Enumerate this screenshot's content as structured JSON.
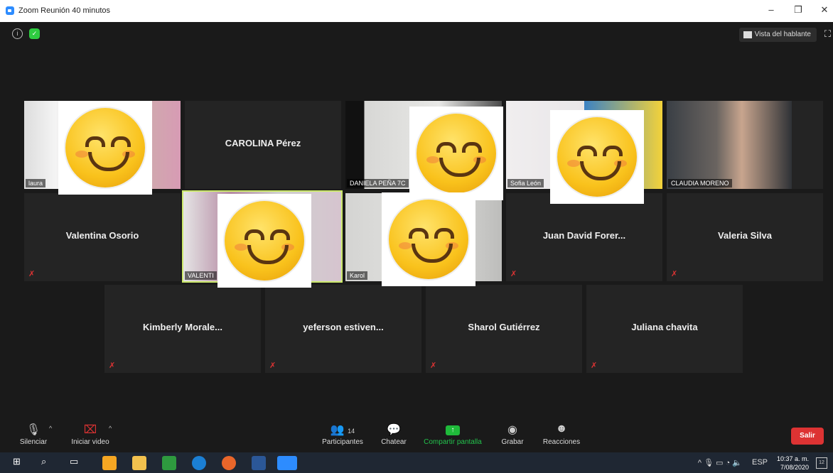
{
  "window": {
    "title": "Zoom Reunión 40 minutos",
    "minimize": "–",
    "restore": "❐",
    "close": "✕"
  },
  "top": {
    "speaker_view": "Vista del hablante"
  },
  "participants": [
    {
      "name": "laura",
      "label": "laura"
    },
    {
      "name": "CAROLINA Pérez"
    },
    {
      "name": "DANIELA PEÑA",
      "label": "DANIELA PEÑA 7C"
    },
    {
      "name": "Sofía León",
      "label": "Sofia León"
    },
    {
      "name": "CLAUDIA MORENO",
      "label": "CLAUDIA MORENO"
    },
    {
      "name": "Valentina Osorio"
    },
    {
      "name": "VALENTINA",
      "label": "VALENTI"
    },
    {
      "name": "Karol",
      "label": "Karol"
    },
    {
      "name": "Juan David Forer..."
    },
    {
      "name": "Valeria Silva"
    },
    {
      "name": "Kimberly  Morale..."
    },
    {
      "name": "yeferson  estiven..."
    },
    {
      "name": "Sharol Gutiérrez"
    },
    {
      "name": "Juliana chavita"
    }
  ],
  "toolbar": {
    "mute": "Silenciar",
    "video": "Iniciar video",
    "participants": "Participantes",
    "participants_count": "14",
    "chat": "Chatear",
    "share": "Compartir pantalla",
    "record": "Grabar",
    "reactions": "Reacciones",
    "leave": "Salir"
  },
  "taskbar": {
    "lang": "ESP",
    "time": "10:37 a. m.",
    "date": "7/08/2020",
    "notif_count": "12"
  }
}
